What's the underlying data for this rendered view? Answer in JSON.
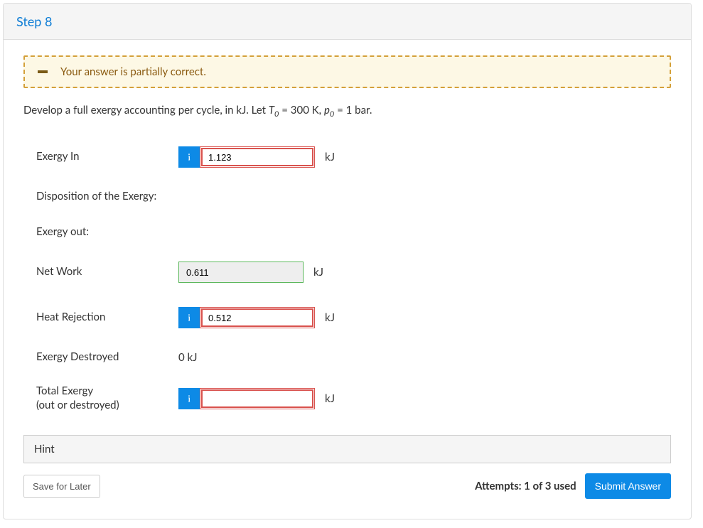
{
  "header": {
    "title": "Step 8"
  },
  "feedback": {
    "message": "Your answer is partially correct."
  },
  "question": {
    "prefix": "Develop a full exergy accounting per cycle, in kJ. Let ",
    "t_sym": "T",
    "t_sub": "0",
    "t_eq": " = 300 K, ",
    "p_sym": "p",
    "p_sub": "0",
    "p_eq": " = 1 bar."
  },
  "fields": {
    "exergy_in": {
      "label": "Exergy In",
      "value": "1.123",
      "unit": "kJ"
    },
    "disposition": {
      "label": "Disposition of the Exergy:"
    },
    "exergy_out": {
      "label": "Exergy out:"
    },
    "net_work": {
      "label": "Net Work",
      "value": "0.611",
      "unit": "kJ"
    },
    "heat_rejection": {
      "label": "Heat Rejection",
      "value": "0.512",
      "unit": "kJ"
    },
    "exergy_destroyed": {
      "label": "Exergy Destroyed",
      "value": "0 kJ"
    },
    "total_exergy": {
      "label_l1": "Total Exergy",
      "label_l2": "(out or destroyed)",
      "value": "",
      "unit": "kJ"
    }
  },
  "hint": {
    "label": "Hint"
  },
  "footer": {
    "save": "Save for Later",
    "attempts": "Attempts: 1 of 3 used",
    "submit": "Submit Answer"
  }
}
